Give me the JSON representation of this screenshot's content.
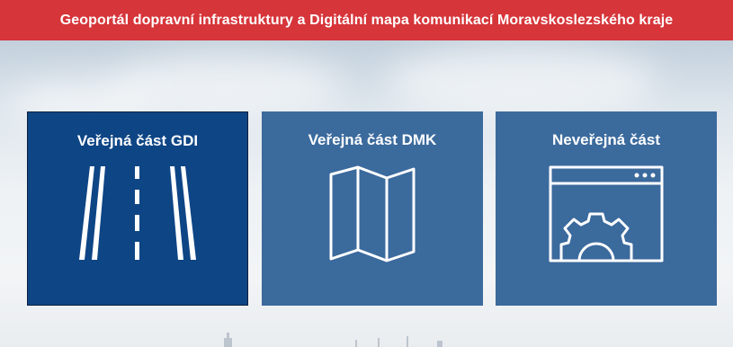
{
  "header": {
    "title": "Geoportál dopravní infrastruktury a Digitální mapa komunikací Moravskoslezského kraje",
    "background_color": "#d6353a"
  },
  "tiles": [
    {
      "label": "Veřejná část GDI",
      "icon": "road-icon",
      "color": "#0e4585",
      "active": true
    },
    {
      "label": "Veřejná část DMK",
      "icon": "map-icon",
      "color": "#3b6a9d",
      "active": false
    },
    {
      "label": "Neveřejná část",
      "icon": "browser-gear-icon",
      "color": "#3b6a9d",
      "active": false
    }
  ]
}
